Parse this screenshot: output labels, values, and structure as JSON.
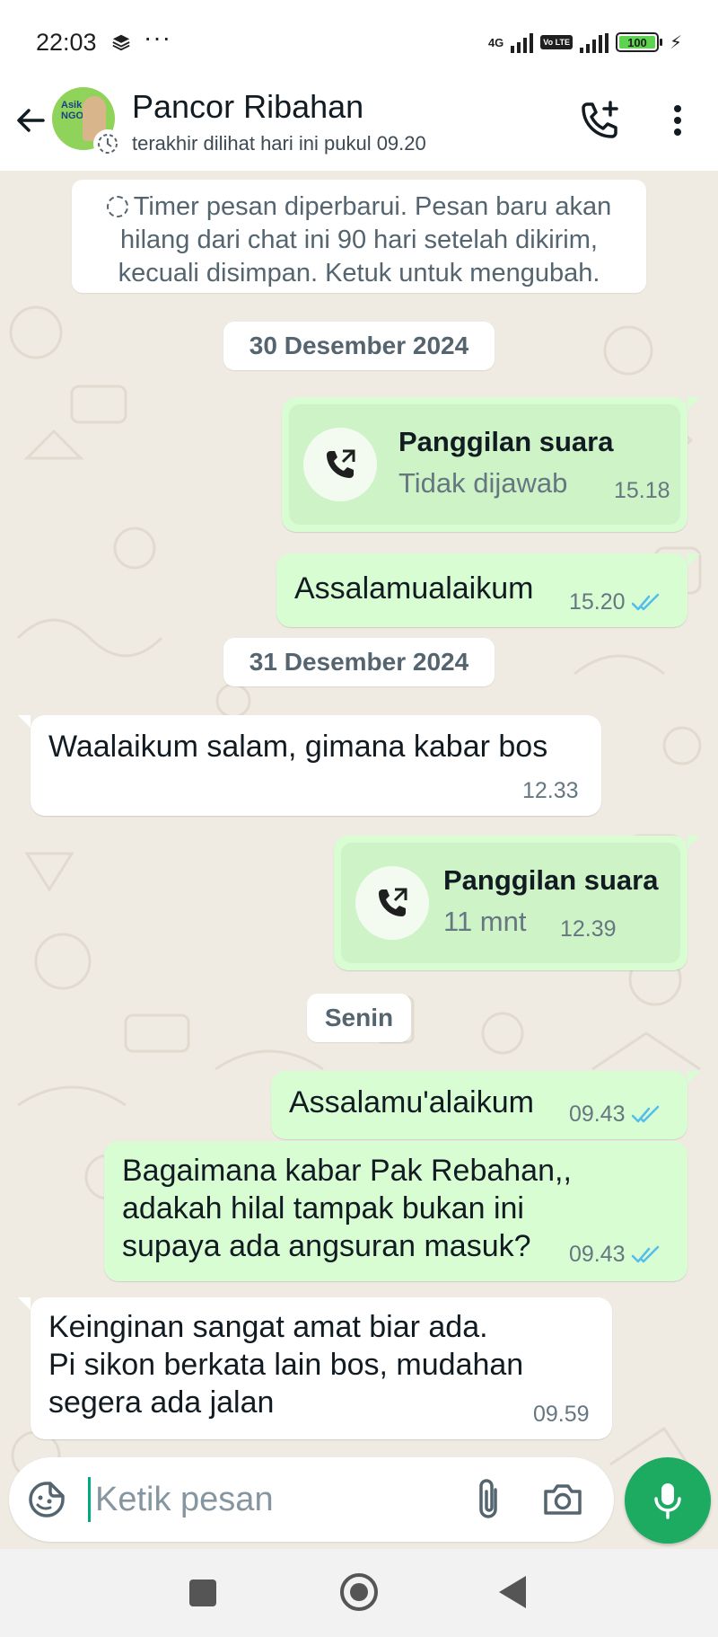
{
  "status_bar": {
    "time": "22:03",
    "network": "4G",
    "volte": "Vo LTE",
    "battery": "100"
  },
  "header": {
    "contact_name": "Pancor Ribahan",
    "last_seen": "terakhir dilihat hari ini pukul 09.20",
    "avatar_text": "Asik NGOPI"
  },
  "chat": {
    "timer_note": "Timer pesan diperbarui. Pesan baru akan hilang dari chat ini 90 hari setelah dikirim, kecuali disimpan. Ketuk untuk mengubah.",
    "date_1": "30 Desember 2024",
    "call_1": {
      "title": "Panggilan suara",
      "status": "Tidak dijawab",
      "time": "15.18"
    },
    "msg_1": {
      "text": "Assalamualaikum",
      "time": "15.20"
    },
    "date_2": "31 Desember 2024",
    "msg_2": {
      "text": "Waalaikum salam, gimana kabar bos",
      "time": "12.33"
    },
    "call_2": {
      "title": "Panggilan suara",
      "status": "11 mnt",
      "time": "12.39"
    },
    "date_3": "Senin",
    "msg_3": {
      "text": "Assalamu'alaikum",
      "time": "09.43"
    },
    "msg_4": {
      "line1": "Bagaimana kabar Pak Rebahan,,",
      "line2": "adakah hilal tampak bukan ini",
      "line3": "supaya ada angsuran masuk?",
      "time": "09.43"
    },
    "msg_5": {
      "line1": "Keinginan sangat amat biar ada.",
      "line2": "Pi sikon berkata lain bos, mudahan",
      "line3": "segera ada jalan",
      "time": "09.59"
    }
  },
  "composer": {
    "placeholder": "Ketik pesan"
  },
  "colors": {
    "accent": "#1daa61",
    "outgoing_bubble": "#d9fdd3",
    "incoming_bubble": "#ffffff",
    "read_ticks": "#53bdeb"
  }
}
